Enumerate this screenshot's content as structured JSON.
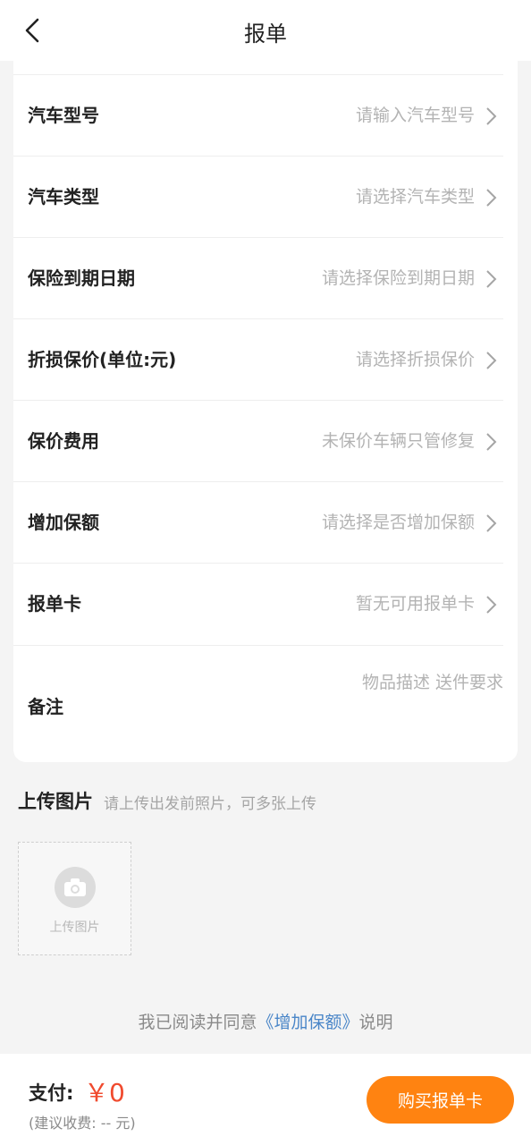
{
  "header": {
    "title": "报单"
  },
  "form": {
    "rows": [
      {
        "label": "汽车型号",
        "value": "请输入汽车型号"
      },
      {
        "label": "汽车类型",
        "value": "请选择汽车类型"
      },
      {
        "label": "保险到期日期",
        "value": "请选择保险到期日期"
      },
      {
        "label": "折损保价(单位:元)",
        "value": "请选择折损保价"
      },
      {
        "label": "保价费用",
        "value": "未保价车辆只管修复"
      },
      {
        "label": "增加保额",
        "value": "请选择是否增加保额"
      },
      {
        "label": "报单卡",
        "value": "暂无可用报单卡"
      }
    ],
    "remark": {
      "label": "备注",
      "placeholder": "物品描述 送件要求"
    }
  },
  "upload": {
    "title": "上传图片",
    "hint": "请上传出发前照片，可多张上传",
    "box_label": "上传图片"
  },
  "agreement": {
    "prefix": "我已阅读并同意",
    "link": "《增加保额》",
    "suffix": "说明"
  },
  "footer": {
    "pay_label": "支付:",
    "pay_amount": "￥0",
    "pay_hint": "(建议收费: -- 元)",
    "buy_button": "购买报单卡"
  },
  "colors": {
    "accent": "#ff8311",
    "price": "#f04a2e",
    "link": "#4a86c8"
  }
}
